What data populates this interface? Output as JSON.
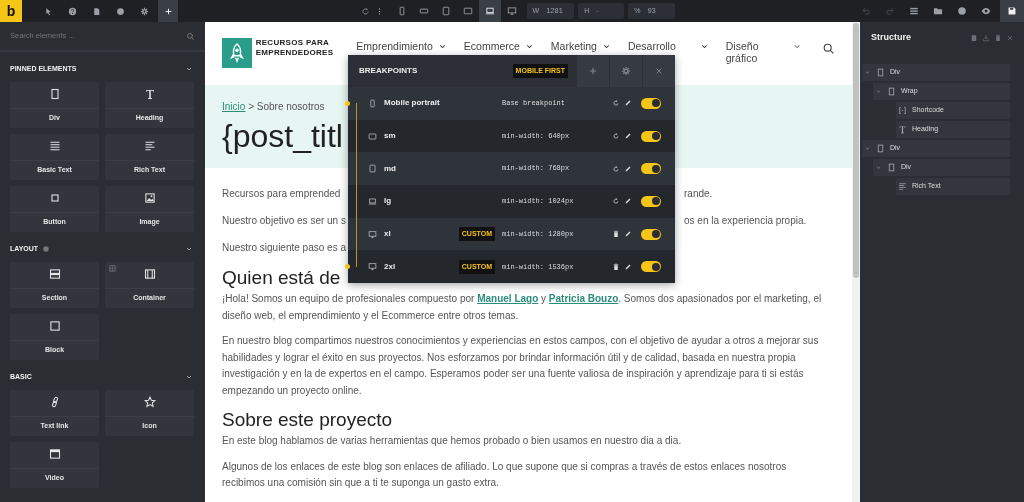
{
  "toolbar": {
    "logo": "b",
    "left_tools": [
      {
        "kind": "pointer",
        "active": false
      },
      {
        "kind": "help",
        "active": false
      },
      {
        "kind": "pages",
        "active": false
      },
      {
        "kind": "circle",
        "active": false
      },
      {
        "kind": "settings",
        "active": false
      },
      {
        "kind": "add",
        "active": true
      }
    ],
    "center_tools": [
      {
        "kind": "refresh"
      },
      {
        "kind": "more"
      }
    ],
    "devices": [
      {
        "kind": "phone",
        "selected": false
      },
      {
        "kind": "phone-landscape",
        "selected": false
      },
      {
        "kind": "tablet",
        "selected": false
      },
      {
        "kind": "tablet-landscape",
        "selected": false
      },
      {
        "kind": "laptop",
        "selected": true
      },
      {
        "kind": "desktop",
        "selected": false
      }
    ],
    "fields": [
      {
        "label": "W",
        "value": "1281"
      },
      {
        "label": "H",
        "placeholder": "-"
      },
      {
        "label": "%",
        "value": "93"
      }
    ],
    "right_tools": [
      {
        "kind": "undo",
        "disabled": true,
        "active": false
      },
      {
        "kind": "redo",
        "disabled": true,
        "active": false
      },
      {
        "kind": "list",
        "disabled": false,
        "active": false
      },
      {
        "kind": "folder",
        "disabled": false,
        "active": false
      },
      {
        "kind": "circle",
        "disabled": false,
        "active": false
      },
      {
        "kind": "eye",
        "disabled": false,
        "active": false
      },
      {
        "kind": "save",
        "disabled": false,
        "active": true
      }
    ]
  },
  "elements_panel": {
    "search": {
      "placeholder": "Search elements ..."
    },
    "groups": [
      {
        "title": "PINNED ELEMENTS",
        "info": false,
        "expanded": true,
        "items": [
          {
            "label": "Div",
            "kind": "div",
            "marker": false
          },
          {
            "label": "Heading",
            "kind": "heading",
            "marker": false
          },
          {
            "label": "Basic Text",
            "kind": "basic-text",
            "marker": false
          },
          {
            "label": "Rich Text",
            "kind": "rich-text",
            "marker": false
          },
          {
            "label": "Button",
            "kind": "button",
            "marker": false
          },
          {
            "label": "Image",
            "kind": "image",
            "marker": false
          }
        ]
      },
      {
        "title": "LAYOUT",
        "info": true,
        "expanded": true,
        "items": [
          {
            "label": "Section",
            "kind": "section",
            "marker": false
          },
          {
            "label": "Container",
            "kind": "container",
            "marker": true
          },
          {
            "label": "Block",
            "kind": "block",
            "marker": false
          }
        ]
      },
      {
        "title": "BASIC",
        "info": false,
        "expanded": true,
        "items": [
          {
            "label": "Text link",
            "kind": "text-link",
            "marker": false
          },
          {
            "label": "Icon",
            "kind": "icon",
            "marker": false
          },
          {
            "label": "Video",
            "kind": "video",
            "marker": false
          }
        ]
      }
    ]
  },
  "site": {
    "logo": [
      "RECURSOS PARA",
      "EMPRENDEDORES"
    ],
    "nav": [
      {
        "label": "Emprendimiento"
      },
      {
        "label": "Ecommerce"
      },
      {
        "label": "Marketing"
      },
      {
        "label": "Desarrollo"
      },
      {
        "label": "Diseño gráfico"
      }
    ],
    "breadcrumb": {
      "link": "Inicio",
      "separator": ">",
      "current": "Sobre nosotros"
    },
    "title": "{post_titl",
    "intro_lines": [
      {
        "left": "Recursos para emprended",
        "right": "rande."
      },
      {
        "left": "Nuestro objetivo es ser un s",
        "right": "os en la experiencia propia."
      },
      {
        "left": "Nuestro siguiente paso es a"
      }
    ],
    "sections": [
      {
        "heading": "Quien está de",
        "paragraphs": [
          [
            {
              "text": "¡Hola! Somos un equipo de profesionales compuesto por ",
              "link": false
            },
            {
              "text": "Manuel Lago",
              "link": true
            },
            {
              "text": " y ",
              "link": false
            },
            {
              "text": "Patricia Bouzo",
              "link": true
            },
            {
              "text": ". Somos dos apasionados por el marketing, el diseño web, el emprendimiento y el Ecommerce entre otros temas.",
              "link": false
            }
          ],
          [
            {
              "text": "En nuestro blog compartimos nuestros conocimientos y experiencias en estos campos, con el objetivo de ayudar a otros a mejorar sus habilidades y lograr el éxito en sus proyectos. Nos esforzamos por brindar información útil y de calidad, basada en nuestra propia investigación y en la de expertos en el campo. Esperamos poder ser una fuente valiosa de inspiración y aprendizaje para ti si estás empezando un proyecto online.",
              "link": false
            }
          ]
        ]
      },
      {
        "heading": "Sobre este proyecto",
        "paragraphs": [
          [
            {
              "text": "En este blog hablamos de varias herramientas que hemos probado o bien usamos en nuestro dia a dia.",
              "link": false
            }
          ],
          [
            {
              "text": "Algunos de los enlaces de este blog son enlaces de afiliado. Lo que supone que si compras a través de estos enlaces nosotros recibimos una comisión sin que a ti te suponga un gasto extra.",
              "link": false
            }
          ]
        ]
      }
    ]
  },
  "breakpoints": {
    "title": "BREAKPOINTS",
    "badge": "MOBILE FIRST",
    "rows": [
      {
        "label": "Mobile portrait",
        "kind": "phone",
        "value": "Base breakpoint",
        "removable": false,
        "on": true
      },
      {
        "label": "sm",
        "kind": "tablet-landscape",
        "value": "min-width: 640px",
        "removable": false,
        "on": true
      },
      {
        "label": "md",
        "kind": "tablet",
        "value": "min-width: 768px",
        "removable": false,
        "on": true
      },
      {
        "label": "lg",
        "kind": "laptop",
        "value": "min-width: 1024px",
        "removable": false,
        "on": true
      },
      {
        "label": "xl",
        "kind": "desktop",
        "badge": "CUSTOM",
        "value": "min-width: 1280px",
        "removable": true,
        "on": true
      },
      {
        "label": "2xl",
        "kind": "desktop",
        "badge": "CUSTOM",
        "value": "min-width: 1536px",
        "removable": true,
        "on": true
      }
    ]
  },
  "structure": {
    "title": "Structure",
    "tree": [
      {
        "label": "Div",
        "kind": "div",
        "expanded": true,
        "children": [
          {
            "label": "Wrap",
            "kind": "div",
            "expanded": true,
            "children": [
              {
                "label": "Shortcode",
                "kind": "shortcode"
              },
              {
                "label": "Heading",
                "kind": "heading"
              }
            ]
          }
        ]
      },
      {
        "label": "Div",
        "kind": "div",
        "expanded": true,
        "children": [
          {
            "label": "Div",
            "kind": "div",
            "expanded": true,
            "children": [
              {
                "label": "Rich Text",
                "kind": "rich-text"
              }
            ]
          }
        ]
      }
    ]
  }
}
